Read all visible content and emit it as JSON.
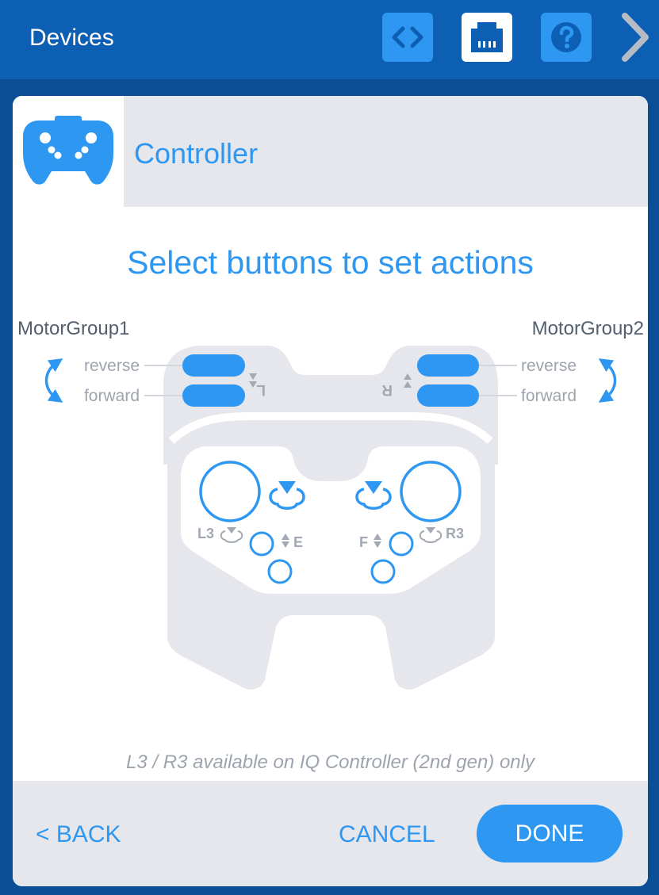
{
  "header": {
    "title": "Devices",
    "icons": [
      "code-icon",
      "port-icon",
      "help-icon",
      "chevron-right-icon"
    ]
  },
  "device": {
    "name": "Controller",
    "icon": "gamepad-icon"
  },
  "main": {
    "heading": "Select buttons to set actions",
    "left_group": {
      "label": "MotorGroup1",
      "reverse_label": "reverse",
      "forward_label": "forward"
    },
    "right_group": {
      "label": "MotorGroup2",
      "reverse_label": "reverse",
      "forward_label": "forward"
    },
    "shoulder_left_letter": "L",
    "shoulder_right_letter": "R",
    "button_l3": "L3",
    "button_r3": "R3",
    "button_e": "E",
    "button_f": "F",
    "note": "L3 / R3 available on IQ Controller (2nd gen) only"
  },
  "footer": {
    "back_label": "< BACK",
    "cancel_label": "CANCEL",
    "done_label": "DONE"
  },
  "colors": {
    "accent": "#2e97f2",
    "header_bg": "#0c5fb3",
    "frame_bg": "#0a4f95",
    "controller_body": "#e6e7ec",
    "muted_text": "#9ea4ae"
  }
}
